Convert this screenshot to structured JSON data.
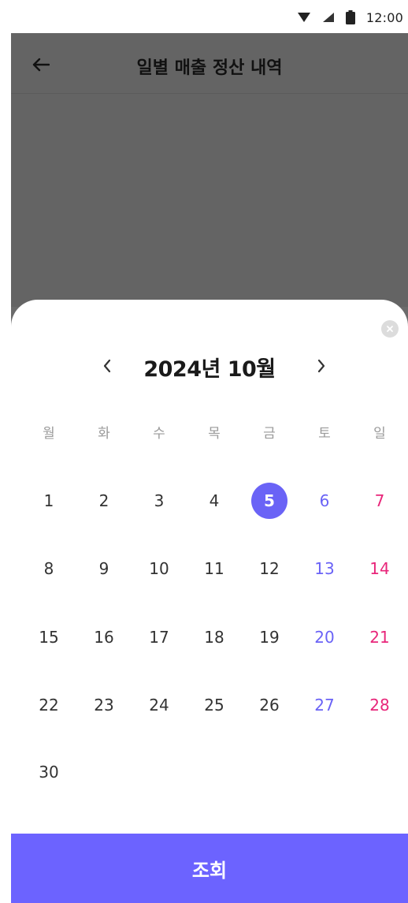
{
  "status_bar": {
    "time": "12:00",
    "icons": [
      "wifi-icon",
      "signal-icon",
      "battery-icon"
    ]
  },
  "header": {
    "title": "일별 매출 정산 내역",
    "back_icon": "arrow-left-icon"
  },
  "calendar": {
    "month_title": "2024년 10월",
    "weekdays": [
      "월",
      "화",
      "수",
      "목",
      "금",
      "토",
      "일"
    ],
    "weeks": [
      [
        "1",
        "2",
        "3",
        "4",
        "5",
        "6",
        "7"
      ],
      [
        "8",
        "9",
        "10",
        "11",
        "12",
        "13",
        "14"
      ],
      [
        "15",
        "16",
        "17",
        "18",
        "19",
        "20",
        "21"
      ],
      [
        "22",
        "23",
        "24",
        "25",
        "26",
        "27",
        "28"
      ],
      [
        "30",
        "",
        "",
        "",
        "",
        "",
        ""
      ]
    ],
    "selected_day": "5",
    "colors": {
      "accent": "#6a63f6",
      "saturday": "#6a63f6",
      "sunday": "#e8267a",
      "weekday_label": "#9a9a9a"
    }
  },
  "sheet": {
    "close_icon": "close-icon",
    "prev_icon": "chevron-left-icon",
    "next_icon": "chevron-right-icon"
  },
  "footer": {
    "submit_label": "조회",
    "button_color": "#6c63ff"
  }
}
